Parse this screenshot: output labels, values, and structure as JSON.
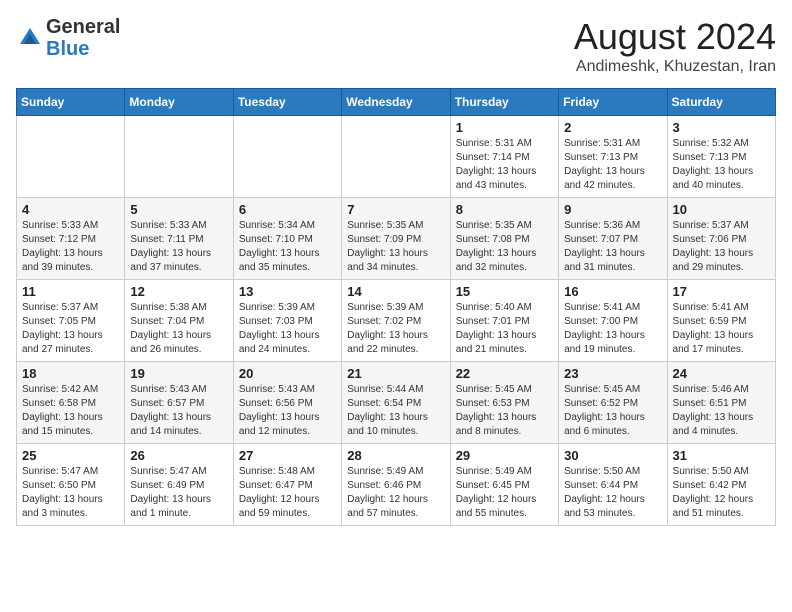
{
  "header": {
    "logo_line1": "General",
    "logo_line2": "Blue",
    "month_year": "August 2024",
    "location": "Andimeshk, Khuzestan, Iran"
  },
  "weekdays": [
    "Sunday",
    "Monday",
    "Tuesday",
    "Wednesday",
    "Thursday",
    "Friday",
    "Saturday"
  ],
  "weeks": [
    [
      {
        "day": "",
        "info": ""
      },
      {
        "day": "",
        "info": ""
      },
      {
        "day": "",
        "info": ""
      },
      {
        "day": "",
        "info": ""
      },
      {
        "day": "1",
        "info": "Sunrise: 5:31 AM\nSunset: 7:14 PM\nDaylight: 13 hours\nand 43 minutes."
      },
      {
        "day": "2",
        "info": "Sunrise: 5:31 AM\nSunset: 7:13 PM\nDaylight: 13 hours\nand 42 minutes."
      },
      {
        "day": "3",
        "info": "Sunrise: 5:32 AM\nSunset: 7:13 PM\nDaylight: 13 hours\nand 40 minutes."
      }
    ],
    [
      {
        "day": "4",
        "info": "Sunrise: 5:33 AM\nSunset: 7:12 PM\nDaylight: 13 hours\nand 39 minutes."
      },
      {
        "day": "5",
        "info": "Sunrise: 5:33 AM\nSunset: 7:11 PM\nDaylight: 13 hours\nand 37 minutes."
      },
      {
        "day": "6",
        "info": "Sunrise: 5:34 AM\nSunset: 7:10 PM\nDaylight: 13 hours\nand 35 minutes."
      },
      {
        "day": "7",
        "info": "Sunrise: 5:35 AM\nSunset: 7:09 PM\nDaylight: 13 hours\nand 34 minutes."
      },
      {
        "day": "8",
        "info": "Sunrise: 5:35 AM\nSunset: 7:08 PM\nDaylight: 13 hours\nand 32 minutes."
      },
      {
        "day": "9",
        "info": "Sunrise: 5:36 AM\nSunset: 7:07 PM\nDaylight: 13 hours\nand 31 minutes."
      },
      {
        "day": "10",
        "info": "Sunrise: 5:37 AM\nSunset: 7:06 PM\nDaylight: 13 hours\nand 29 minutes."
      }
    ],
    [
      {
        "day": "11",
        "info": "Sunrise: 5:37 AM\nSunset: 7:05 PM\nDaylight: 13 hours\nand 27 minutes."
      },
      {
        "day": "12",
        "info": "Sunrise: 5:38 AM\nSunset: 7:04 PM\nDaylight: 13 hours\nand 26 minutes."
      },
      {
        "day": "13",
        "info": "Sunrise: 5:39 AM\nSunset: 7:03 PM\nDaylight: 13 hours\nand 24 minutes."
      },
      {
        "day": "14",
        "info": "Sunrise: 5:39 AM\nSunset: 7:02 PM\nDaylight: 13 hours\nand 22 minutes."
      },
      {
        "day": "15",
        "info": "Sunrise: 5:40 AM\nSunset: 7:01 PM\nDaylight: 13 hours\nand 21 minutes."
      },
      {
        "day": "16",
        "info": "Sunrise: 5:41 AM\nSunset: 7:00 PM\nDaylight: 13 hours\nand 19 minutes."
      },
      {
        "day": "17",
        "info": "Sunrise: 5:41 AM\nSunset: 6:59 PM\nDaylight: 13 hours\nand 17 minutes."
      }
    ],
    [
      {
        "day": "18",
        "info": "Sunrise: 5:42 AM\nSunset: 6:58 PM\nDaylight: 13 hours\nand 15 minutes."
      },
      {
        "day": "19",
        "info": "Sunrise: 5:43 AM\nSunset: 6:57 PM\nDaylight: 13 hours\nand 14 minutes."
      },
      {
        "day": "20",
        "info": "Sunrise: 5:43 AM\nSunset: 6:56 PM\nDaylight: 13 hours\nand 12 minutes."
      },
      {
        "day": "21",
        "info": "Sunrise: 5:44 AM\nSunset: 6:54 PM\nDaylight: 13 hours\nand 10 minutes."
      },
      {
        "day": "22",
        "info": "Sunrise: 5:45 AM\nSunset: 6:53 PM\nDaylight: 13 hours\nand 8 minutes."
      },
      {
        "day": "23",
        "info": "Sunrise: 5:45 AM\nSunset: 6:52 PM\nDaylight: 13 hours\nand 6 minutes."
      },
      {
        "day": "24",
        "info": "Sunrise: 5:46 AM\nSunset: 6:51 PM\nDaylight: 13 hours\nand 4 minutes."
      }
    ],
    [
      {
        "day": "25",
        "info": "Sunrise: 5:47 AM\nSunset: 6:50 PM\nDaylight: 13 hours\nand 3 minutes."
      },
      {
        "day": "26",
        "info": "Sunrise: 5:47 AM\nSunset: 6:49 PM\nDaylight: 13 hours\nand 1 minute."
      },
      {
        "day": "27",
        "info": "Sunrise: 5:48 AM\nSunset: 6:47 PM\nDaylight: 12 hours\nand 59 minutes."
      },
      {
        "day": "28",
        "info": "Sunrise: 5:49 AM\nSunset: 6:46 PM\nDaylight: 12 hours\nand 57 minutes."
      },
      {
        "day": "29",
        "info": "Sunrise: 5:49 AM\nSunset: 6:45 PM\nDaylight: 12 hours\nand 55 minutes."
      },
      {
        "day": "30",
        "info": "Sunrise: 5:50 AM\nSunset: 6:44 PM\nDaylight: 12 hours\nand 53 minutes."
      },
      {
        "day": "31",
        "info": "Sunrise: 5:50 AM\nSunset: 6:42 PM\nDaylight: 12 hours\nand 51 minutes."
      }
    ]
  ]
}
